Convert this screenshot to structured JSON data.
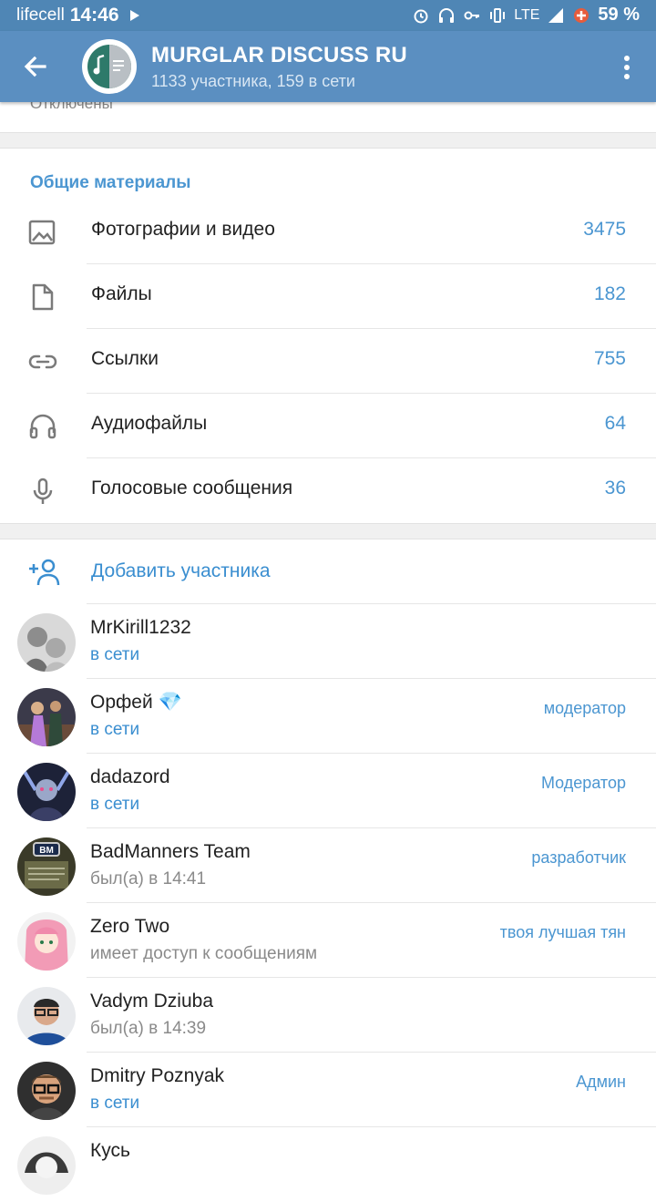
{
  "statusbar": {
    "carrier": "lifecell",
    "time": "14:46",
    "network": "LTE",
    "battery": "59 %"
  },
  "header": {
    "title": "MURGLAR DISCUSS RU",
    "subtitle": "1133 участника, 159 в сети"
  },
  "cut_row_text": "Отключены",
  "shared_media": {
    "title": "Общие материалы",
    "items": [
      {
        "icon": "photo-icon",
        "label": "Фотографии и видео",
        "count": "3475"
      },
      {
        "icon": "file-icon",
        "label": "Файлы",
        "count": "182"
      },
      {
        "icon": "link-icon",
        "label": "Ссылки",
        "count": "755"
      },
      {
        "icon": "headphones-icon",
        "label": "Аудиофайлы",
        "count": "64"
      },
      {
        "icon": "microphone-icon",
        "label": "Голосовые сообщения",
        "count": "36"
      }
    ]
  },
  "add_member": {
    "label": "Добавить участника"
  },
  "members": [
    {
      "name": "MrKirill1232",
      "status": "в сети",
      "role": ""
    },
    {
      "name": "Орфей 💎",
      "status": "в сети",
      "role": "модератор"
    },
    {
      "name": "dadazord",
      "status": "в сети",
      "role": "Модератор"
    },
    {
      "name": "BadManners Team",
      "status": "был(а) в 14:41",
      "role": "разработчик"
    },
    {
      "name": "Zero Two",
      "status": "имеет доступ к сообщениям",
      "role": "твоя лучшая тян"
    },
    {
      "name": "Vadym Dziuba",
      "status": "был(а) в 14:39",
      "role": ""
    },
    {
      "name": "Dmitry Poznyak",
      "status": "в сети",
      "role": "Админ"
    },
    {
      "name": "Кусь",
      "status": "",
      "role": ""
    }
  ],
  "colors": {
    "statusbar": "#4f86b5",
    "header": "#5b8fc1",
    "accent": "#4b96d1",
    "online": "#3a8ed0"
  }
}
